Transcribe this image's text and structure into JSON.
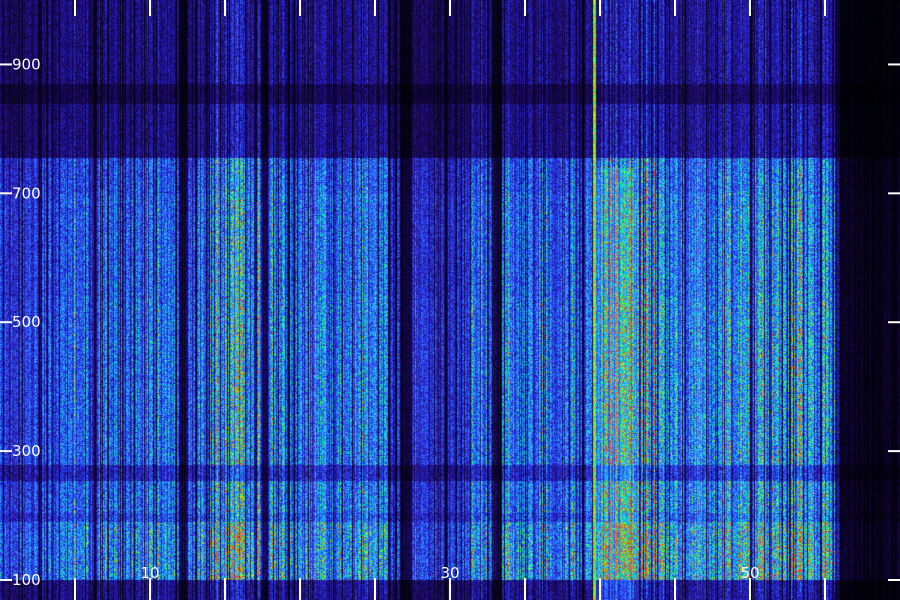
{
  "chart_data": {
    "type": "heatmap",
    "xlabel": "",
    "ylabel": "",
    "xlim": [
      0,
      60
    ],
    "ylim": [
      100,
      1000
    ],
    "x_ticks": [
      0,
      5,
      10,
      15,
      20,
      25,
      30,
      35,
      40,
      45,
      50,
      55
    ],
    "x_tick_labels": [
      {
        "value": 10,
        "label": "10"
      },
      {
        "value": 30,
        "label": "30"
      },
      {
        "value": 50,
        "label": "50"
      }
    ],
    "y_ticks": [
      100,
      300,
      500,
      700,
      900
    ],
    "y_tick_labels": [
      {
        "value": 100,
        "label": "100"
      },
      {
        "value": 300,
        "label": "300"
      },
      {
        "value": 500,
        "label": "500"
      },
      {
        "value": 700,
        "label": "700"
      },
      {
        "value": 900,
        "label": "900"
      }
    ],
    "colormap": [
      "#000000",
      "#1e0a6e",
      "#2a2ee8",
      "#2e7bff",
      "#21c7ff",
      "#00ff80",
      "#c8ff00",
      "#ff5000"
    ],
    "bright_line": {
      "x": 39.6,
      "color": "#2dff3a"
    },
    "dim_band": {
      "y_from": 755,
      "y_to": 1000
    }
  }
}
